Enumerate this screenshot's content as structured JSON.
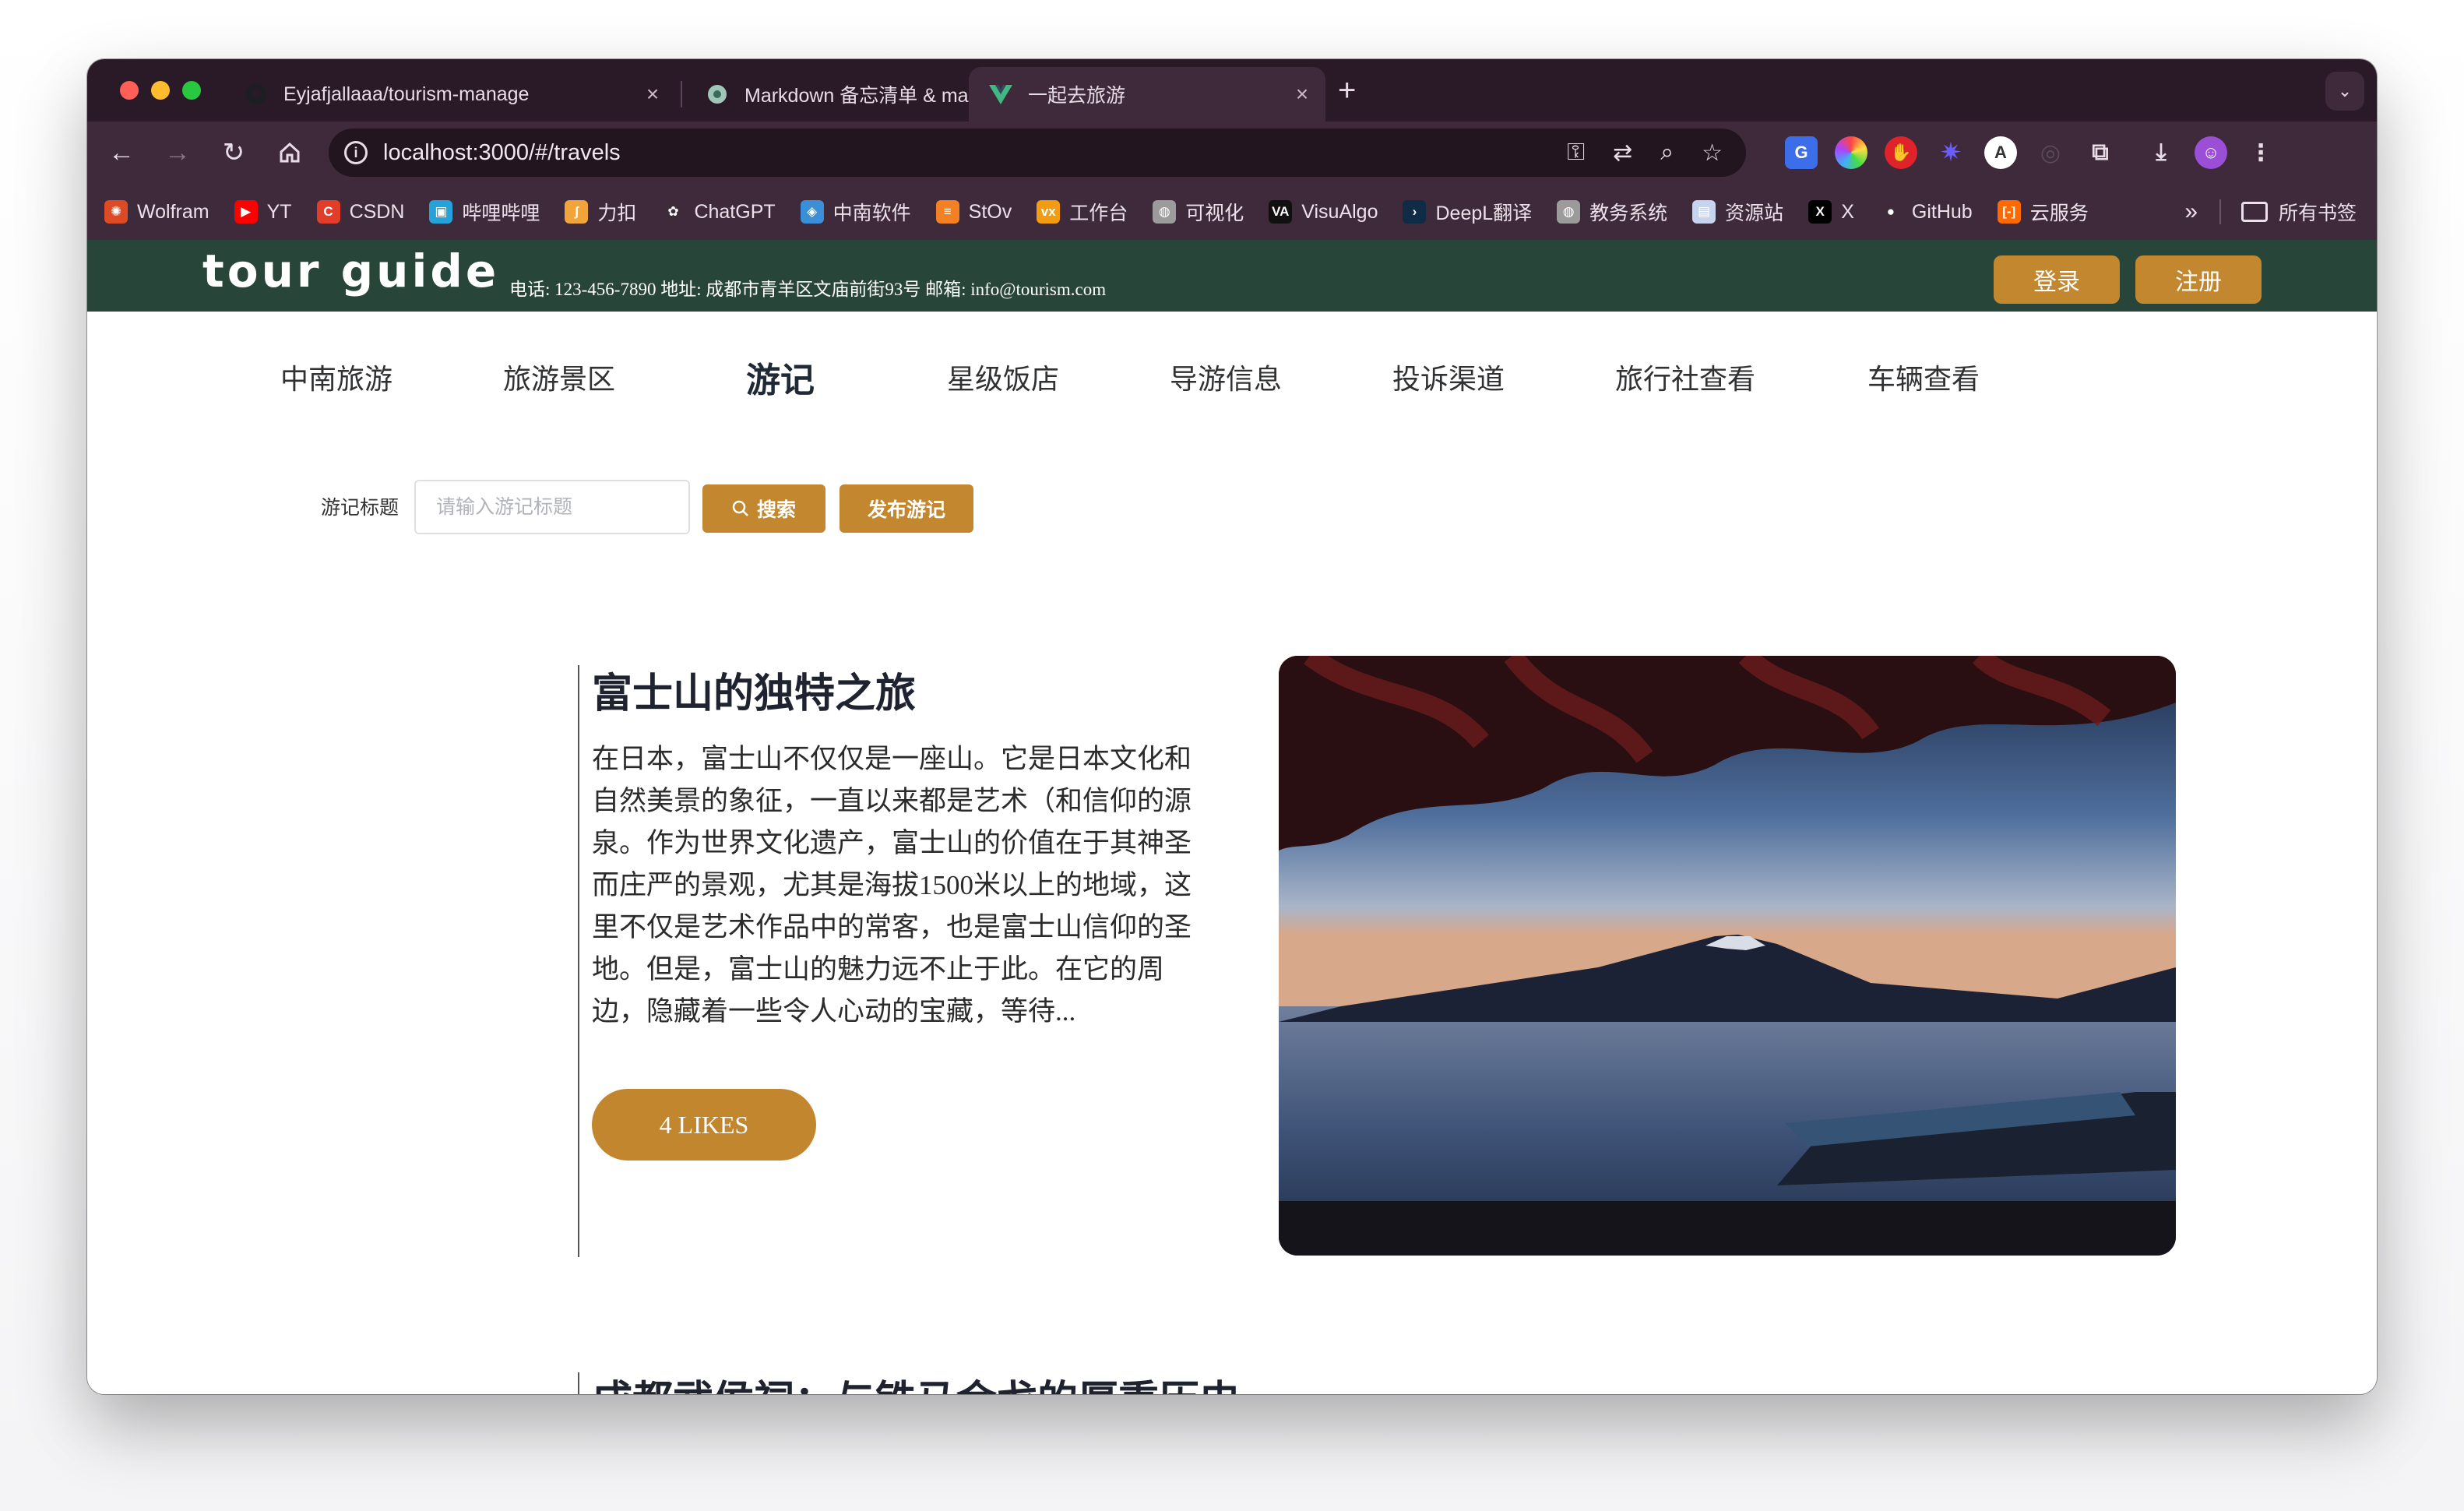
{
  "browser": {
    "tabs": [
      {
        "title": "Eyjafjallaaa/tourism-manage",
        "icon": "github-icon",
        "close": "×"
      },
      {
        "title": "Markdown 备忘清单 & markdo",
        "icon": "markdown-site-icon",
        "close": "×"
      },
      {
        "title": "一起去旅游",
        "icon": "vue-icon",
        "close": "×"
      }
    ],
    "new_tab": "+",
    "url": "localhost:3000/#/travels",
    "bookmarks": [
      {
        "label": "Wolfram",
        "icon": "wolfram-icon",
        "color": "#dd4b24"
      },
      {
        "label": "YT",
        "icon": "youtube-icon",
        "color": "#ff0000"
      },
      {
        "label": "CSDN",
        "icon": "csdn-icon",
        "color": "#e23d28"
      },
      {
        "label": "哔哩哔哩",
        "icon": "bilibili-icon",
        "color": "#23a3d9"
      },
      {
        "label": "力扣",
        "icon": "leetcode-icon",
        "color": "#f0a43a"
      },
      {
        "label": "ChatGPT",
        "icon": "chatgpt-icon",
        "color": "#ffffff"
      },
      {
        "label": "中南软件",
        "icon": "csu-icon",
        "color": "#3b8fd6"
      },
      {
        "label": "StOv",
        "icon": "stackoverflow-icon",
        "color": "#f48024"
      },
      {
        "label": "工作台",
        "icon": "vx-icon",
        "color": "#f39c12"
      },
      {
        "label": "可视化",
        "icon": "globe-icon",
        "color": "#9b9b9b"
      },
      {
        "label": "VisuAlgo",
        "icon": "visualgo-icon",
        "color": "#111111"
      },
      {
        "label": "DeepL翻译",
        "icon": "deepl-icon",
        "color": "#0f2b46"
      },
      {
        "label": "教务系统",
        "icon": "globe-icon",
        "color": "#9b9b9b"
      },
      {
        "label": "资源站",
        "icon": "resource-icon",
        "color": "#c7d4f0"
      },
      {
        "label": "X",
        "icon": "x-icon",
        "color": "#000000"
      },
      {
        "label": "GitHub",
        "icon": "github-icon",
        "color": "#ffffff"
      },
      {
        "label": "云服务",
        "icon": "aliyun-icon",
        "color": "#ff6a00"
      }
    ],
    "bookmarks_more": "»",
    "all_bookmarks": "所有书签"
  },
  "site": {
    "logo": "tour guide",
    "contact": "电话: 123-456-7890 地址: 成都市青羊区文庙前街93号 邮箱: info@tourism.com",
    "login": "登录",
    "register": "注册",
    "nav": [
      "中南旅游",
      "旅游景区",
      "游记",
      "星级饭店",
      "导游信息",
      "投诉渠道",
      "旅行社查看",
      "车辆查看"
    ],
    "active_nav": "游记",
    "search_label": "游记标题",
    "search_placeholder": "请输入游记标题",
    "search_button": "搜索",
    "publish_button": "发布游记"
  },
  "posts": [
    {
      "title": "富士山的独特之旅",
      "body": "在日本，富士山不仅仅是一座山。它是日本文化和自然美景的象征，一直以来都是艺术（和信仰的源泉。作为世界文化遗产，富士山的价值在于其神圣而庄严的景观，尤其是海拔1500米以上的地域，这里不仅是艺术作品中的常客，也是富士山信仰的圣地。但是，富士山的魅力远不止于此。在它的周边，隐藏着一些令人心动的宝藏，等待...",
      "likes": "4 LIKES",
      "image": "mount-fuji-lake-photo"
    },
    {
      "title": "成都武侯祠：与铁马金戈的厚重历史"
    }
  ],
  "colors": {
    "header_green": "#284539",
    "gold": "#c2872f",
    "browser_frame": "#3e2a3b"
  }
}
